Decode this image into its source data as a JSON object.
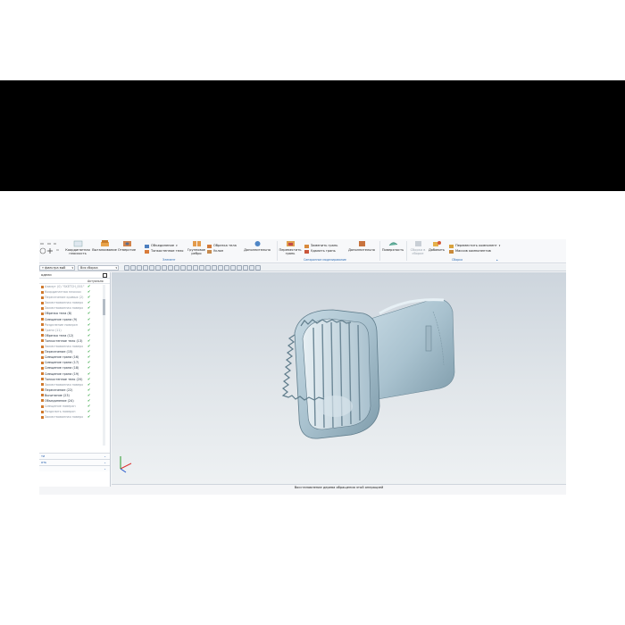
{
  "ribbon": {
    "buttons": [
      {
        "label": "Координатная\nплоскость"
      },
      {
        "label": "Выталкивание"
      },
      {
        "label": "Отверстие"
      }
    ],
    "merge": {
      "top": "Объединение",
      "bottom": "Тонкостенное тело"
    },
    "groupBody": {
      "label": "Групповое\nребро"
    },
    "trimBody": {
      "top": "Обрезка тела",
      "bottom": "Уклон"
    },
    "additional1": {
      "label": "Дополнительно"
    },
    "replaceFace": {
      "label": "Переместить\nгрань"
    },
    "faceOps": {
      "top": "Заменить грань",
      "bottom": "Удалить грань"
    },
    "additional2": {
      "label": "Дополнительно"
    },
    "surface": {
      "label": "Поверхность"
    },
    "component": {
      "label": "Сборка в\nсборке"
    },
    "add": {
      "label": "Добавить"
    },
    "assemblyOps": {
      "top": "Переместить компонент",
      "bottom": "Массив компонентов"
    },
    "groups": {
      "features": "Элемент",
      "sync": "Синхронное моделирование",
      "assembly": "Сборка"
    }
  },
  "filterbar": {
    "filter": "т фильтра выб",
    "assembly": "Вся сборка"
  },
  "navigator": {
    "title": "одели",
    "col_update": "Актуально",
    "items": [
      {
        "label": "Азимут (0) \"SKETCH_001\"",
        "dim": true
      },
      {
        "label": "Координатная плоскос",
        "dim": true
      },
      {
        "label": "Пересечение кривых (2)",
        "dim": true
      },
      {
        "label": "Заимствованная поверх",
        "dim": true
      },
      {
        "label": "Заимствованная поверх",
        "dim": true
      },
      {
        "label": "Обрезка тела (8)",
        "dim": false
      },
      {
        "label": "Смещение грани (9)",
        "dim": false
      },
      {
        "label": "Разделение поверхн",
        "dim": true
      },
      {
        "label": "Грани (11)",
        "dim": true
      },
      {
        "label": "Обрезка тела (12)",
        "dim": false
      },
      {
        "label": "Тонкостенное тело (13)",
        "dim": false
      },
      {
        "label": "Заимствованная поверх",
        "dim": true
      },
      {
        "label": "Пересечение (15)",
        "dim": false
      },
      {
        "label": "Смещение грани (16)",
        "dim": false
      },
      {
        "label": "Смещение грани (17)",
        "dim": false
      },
      {
        "label": "Смещение грани (18)",
        "dim": false
      },
      {
        "label": "Смещение грани (19)",
        "dim": false
      },
      {
        "label": "Тонкостенное тело (20)",
        "dim": false
      },
      {
        "label": "Заимствованная поверх",
        "dim": true
      },
      {
        "label": "Пересечение (22)",
        "dim": false
      },
      {
        "label": "Вычитание (23)",
        "dim": false
      },
      {
        "label": "Объединение (24)",
        "dim": false
      },
      {
        "label": "Смещение поверхн",
        "dim": true
      },
      {
        "label": "Разделить поверхн",
        "dim": true
      },
      {
        "label": "Заимствованная поверх",
        "dim": true
      }
    ],
    "panels": [
      "ти",
      "ать"
    ]
  },
  "status": {
    "message": "Восстановление дерева обращения этой операцией"
  },
  "colors": {
    "accent": "#2e6db4",
    "check": "#1a9a2a",
    "model": "#9eb8c6"
  }
}
